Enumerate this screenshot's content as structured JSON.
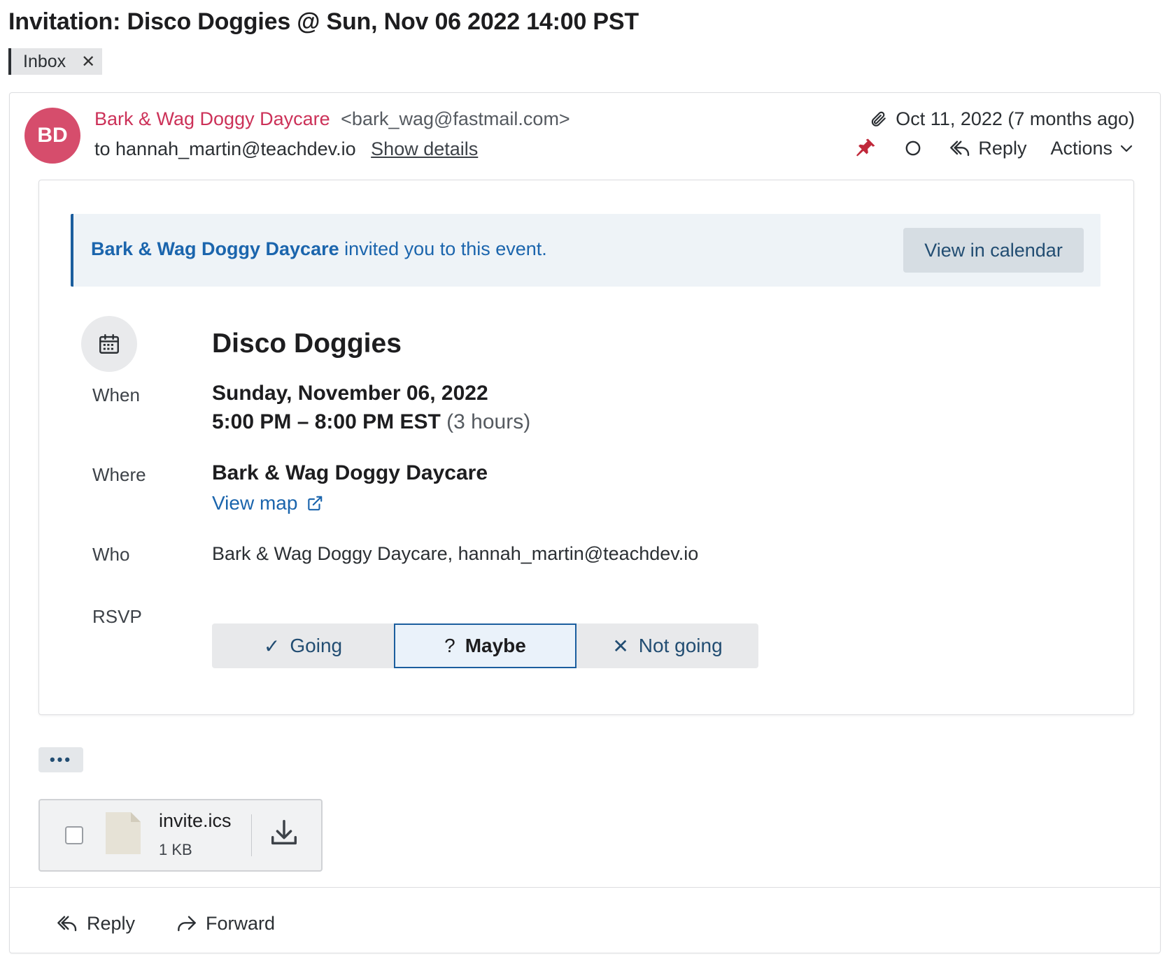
{
  "subject": "Invitation: Disco Doggies @ Sun, Nov 06 2022 14:00 PST",
  "labels": [
    {
      "name": "Inbox",
      "remove": "✕"
    }
  ],
  "message": {
    "avatar_initials": "BD",
    "sender_name": "Bark & Wag Doggy Daycare",
    "sender_email": "<bark_wag@fastmail.com>",
    "to": "to hannah_martin@teachdev.io",
    "show_details": "Show details",
    "date": "Oct 11, 2022 (7 months ago)",
    "reply_label": "Reply",
    "actions_label": "Actions"
  },
  "invite": {
    "banner_sender": "Bark & Wag Doggy Daycare",
    "banner_text": " invited you to this event.",
    "view_calendar": "View in calendar",
    "title": "Disco Doggies",
    "when_label": "When",
    "when_date": "Sunday, November 06, 2022",
    "when_time": "5:00 PM – 8:00 PM EST",
    "when_duration": "(3 hours)",
    "where_label": "Where",
    "where_value": "Bark & Wag Doggy Daycare",
    "view_map": "View map",
    "who_label": "Who",
    "who_value": "Bark & Wag Doggy Daycare, hannah_martin@teachdev.io",
    "rsvp_label": "RSVP",
    "rsvp_options": [
      {
        "glyph": "✓",
        "label": "Going"
      },
      {
        "glyph": "?",
        "label": "Maybe"
      },
      {
        "glyph": "✕",
        "label": "Not going"
      }
    ],
    "rsvp_selected": "Maybe"
  },
  "more_label": "•••",
  "attachment": {
    "name": "invite.ics",
    "size": "1 KB"
  },
  "footer": {
    "reply": "Reply",
    "forward": "Forward"
  },
  "colors": {
    "sender_accent": "#cc3158",
    "link_blue": "#1b65ad",
    "pin_red": "#c0283a"
  }
}
